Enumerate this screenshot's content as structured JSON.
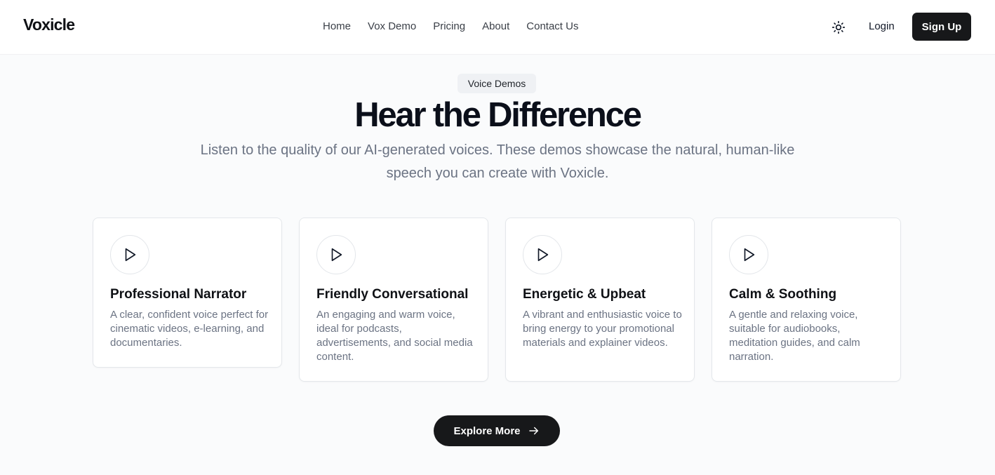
{
  "header": {
    "logo": "Voxicle",
    "nav": [
      "Home",
      "Vox Demo",
      "Pricing",
      "About",
      "Contact Us"
    ],
    "theme_icon": "sun-icon",
    "login_label": "Login",
    "signup_label": "Sign Up"
  },
  "hero": {
    "badge": "Voice Demos",
    "title": "Hear the Difference",
    "subtitle": "Listen to the quality of our AI-generated voices. These demos showcase the natural, human-like speech you can create with Voxicle."
  },
  "cards": [
    {
      "title": "Professional Narrator",
      "description": "A clear, confident voice perfect for cinematic videos, e-learning, and documentaries.",
      "icon": "play-icon"
    },
    {
      "title": "Friendly Conversational",
      "description": "An engaging and warm voice, ideal for podcasts, advertisements, and social media content.",
      "icon": "play-icon"
    },
    {
      "title": "Energetic & Upbeat",
      "description": "A vibrant and enthusiastic voice to bring energy to your promotional materials and explainer videos.",
      "icon": "play-icon"
    },
    {
      "title": "Calm & Soothing",
      "description": "A gentle and relaxing voice, suitable for audiobooks, meditation guides, and calm narration.",
      "icon": "play-icon"
    }
  ],
  "cta": {
    "label": "Explore More",
    "icon": "arrow-right-icon"
  },
  "colors": {
    "background": "#fafbfc",
    "primary_dark": "#17181a",
    "muted_text": "#6b7383",
    "badge_bg": "#eff1f4"
  }
}
